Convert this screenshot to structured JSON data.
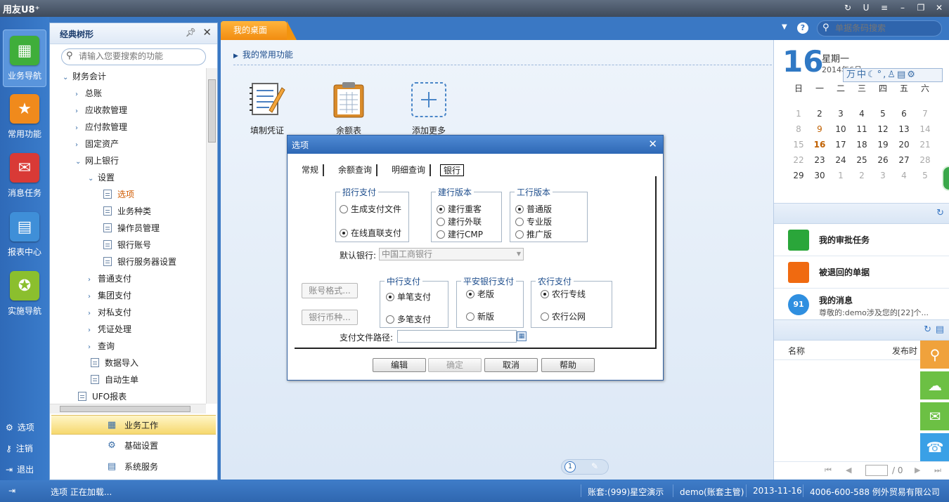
{
  "app": {
    "title": "用友U8⁺"
  },
  "iconbar": {
    "items": [
      {
        "label": "业务导航",
        "color": "#3fae3a",
        "icon": "business-nav-icon"
      },
      {
        "label": "常用功能",
        "color": "#f08a1c",
        "icon": "star-icon"
      },
      {
        "label": "消息任务",
        "color": "#d93a36",
        "icon": "mail-icon"
      },
      {
        "label": "报表中心",
        "color": "#3f8fd8",
        "icon": "report-icon"
      },
      {
        "label": "实施导航",
        "color": "#8bbf2e",
        "icon": "compass-icon"
      }
    ],
    "bottom": [
      {
        "label": "选项",
        "icon": "gear-icon"
      },
      {
        "label": "注销",
        "icon": "key-icon"
      },
      {
        "label": "退出",
        "icon": "exit-icon"
      }
    ]
  },
  "tree": {
    "title": "经典树形",
    "search_placeholder": "请输入您要搜索的功能",
    "nodes": [
      {
        "label": "财务会计",
        "arrow": "⌄",
        "indent": 18
      },
      {
        "label": "总账",
        "arrow": "›",
        "indent": 36
      },
      {
        "label": "应收款管理",
        "arrow": "›",
        "indent": 36
      },
      {
        "label": "应付款管理",
        "arrow": "›",
        "indent": 36
      },
      {
        "label": "固定资产",
        "arrow": "›",
        "indent": 36
      },
      {
        "label": "网上银行",
        "arrow": "⌄",
        "indent": 36
      },
      {
        "label": "设置",
        "arrow": "⌄",
        "indent": 54
      },
      {
        "label": "选项",
        "doc": true,
        "indent": 76,
        "selected": true
      },
      {
        "label": "业务种类",
        "doc": true,
        "indent": 76
      },
      {
        "label": "操作员管理",
        "doc": true,
        "indent": 76
      },
      {
        "label": "银行账号",
        "doc": true,
        "indent": 76
      },
      {
        "label": "银行服务器设置",
        "doc": true,
        "indent": 76
      },
      {
        "label": "普通支付",
        "arrow": "›",
        "indent": 54
      },
      {
        "label": "集团支付",
        "arrow": "›",
        "indent": 54
      },
      {
        "label": "对私支付",
        "arrow": "›",
        "indent": 54
      },
      {
        "label": "凭证处理",
        "arrow": "›",
        "indent": 54
      },
      {
        "label": "查询",
        "arrow": "›",
        "indent": 54
      },
      {
        "label": "数据导入",
        "doc": true,
        "indent": 58
      },
      {
        "label": "自动生单",
        "doc": true,
        "indent": 58
      },
      {
        "label": "UFO报表",
        "doc": true,
        "indent": 40
      }
    ],
    "tabs": [
      {
        "label": "业务工作",
        "active": true
      },
      {
        "label": "基础设置"
      },
      {
        "label": "系统服务"
      }
    ]
  },
  "main": {
    "tab": "我的桌面",
    "section": "我的常用功能",
    "functions": [
      {
        "label": "填制凭证"
      },
      {
        "label": "余额表"
      },
      {
        "label": "添加更多"
      }
    ],
    "page": "1"
  },
  "topright": {
    "search_placeholder": "单据条码搜索"
  },
  "calendar": {
    "day": "16",
    "weekday": "星期一",
    "yearmon": "2014年6月",
    "ime": "万中☾°,♙▤⚙",
    "headers": [
      "日",
      "一",
      "二",
      "三",
      "四",
      "五",
      "六"
    ],
    "rows": [
      [
        "1",
        "2",
        "3",
        "4",
        "5",
        "6",
        "7"
      ],
      [
        "8",
        "9",
        "10",
        "11",
        "12",
        "13",
        "14"
      ],
      [
        "15",
        "16",
        "17",
        "18",
        "19",
        "20",
        "21"
      ],
      [
        "22",
        "23",
        "24",
        "25",
        "26",
        "27",
        "28"
      ],
      [
        "29",
        "30",
        "1",
        "2",
        "3",
        "4",
        "5"
      ]
    ]
  },
  "tasks": [
    {
      "title": "我的审批任务",
      "color": "#2aa63a"
    },
    {
      "title": "被退回的单据",
      "color": "#f06a10"
    },
    {
      "title": "我的消息",
      "subtitle": "尊敬的:demo涉及您的[22]个...",
      "badge": "91",
      "color": "#2f8fe0"
    }
  ],
  "list": {
    "col1": "名称",
    "col2": "发布时",
    "pager_total": "/ 0"
  },
  "floatbuttons": [
    {
      "icon": "search-icon",
      "color": "#f0a23c"
    },
    {
      "icon": "cloud-icon",
      "color": "#6cc044"
    },
    {
      "icon": "chat-icon",
      "color": "#6cc044"
    },
    {
      "icon": "service-icon",
      "color": "#3aa0e6"
    }
  ],
  "status": {
    "left": "选项 正在加载...",
    "account": "账套:(999)星空演示",
    "user": "demo(账套主管)",
    "date": "2013-11-16",
    "company": "4006-600-588 例外贸易有限公司"
  },
  "dialog": {
    "title": "选项",
    "tabs": [
      "常规",
      "余额查询",
      "明细查询",
      "银行"
    ],
    "active_tab": "银行",
    "groups": {
      "zhaohang": {
        "legend": "招行支付",
        "options": [
          "生成支付文件",
          "在线直联支付"
        ],
        "selected": 1
      },
      "jianhang": {
        "legend": "建行版本",
        "options": [
          "建行重客",
          "建行外联",
          "建行CMP"
        ],
        "selected": 0
      },
      "gonghang": {
        "legend": "工行版本",
        "options": [
          "普通版",
          "专业版",
          "推广版"
        ],
        "selected": 0
      },
      "zhonghang": {
        "legend": "中行支付",
        "options": [
          "单笔支付",
          "多笔支付"
        ],
        "selected": 0
      },
      "pingan": {
        "legend": "平安银行支付",
        "options": [
          "老版",
          "新版"
        ],
        "selected": 0
      },
      "nonghang": {
        "legend": "农行支付",
        "options": [
          "农行专线",
          "农行公网"
        ],
        "selected": 0
      }
    },
    "default_bank_label": "默认银行:",
    "default_bank_value": "中国工商银行",
    "account_format_btn": "账号格式...",
    "bank_currency_btn": "银行币种...",
    "pay_path_label": "支付文件路径:",
    "pay_path_value": "",
    "buttons": {
      "edit": "编辑",
      "ok": "确定",
      "cancel": "取消",
      "help": "帮助"
    }
  }
}
